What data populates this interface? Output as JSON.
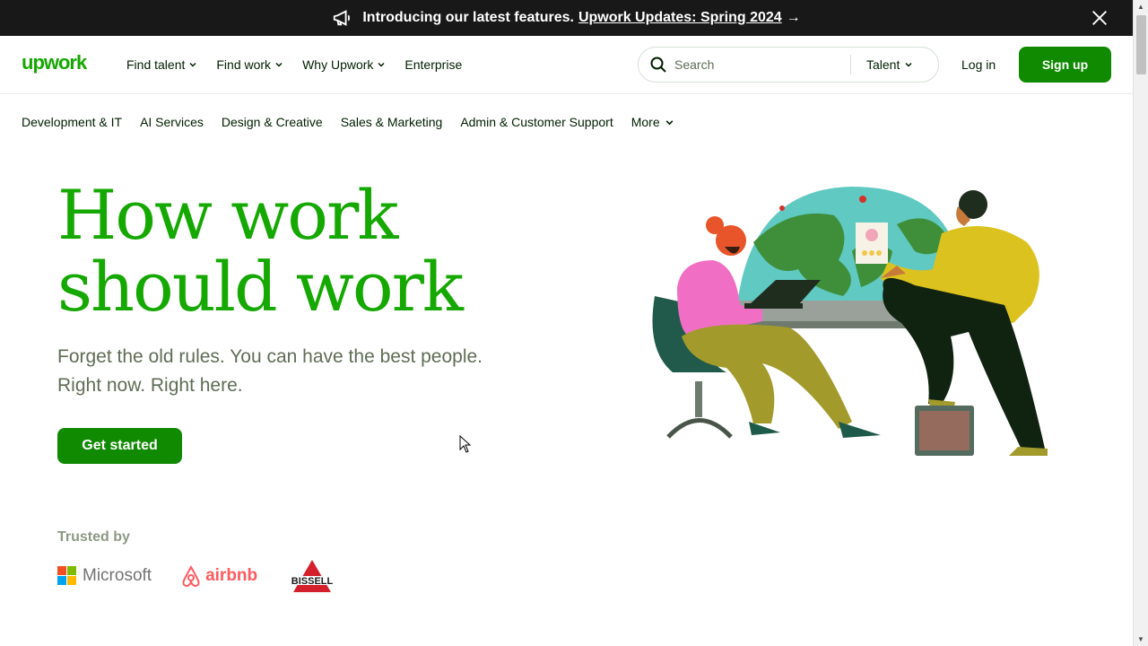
{
  "announcement": {
    "text": "Introducing our latest features.",
    "link": "Upwork Updates: Spring 2024",
    "arrow": "→",
    "icon": "megaphone-icon"
  },
  "header": {
    "logo": "upwork",
    "nav": [
      "Find talent",
      "Find work",
      "Why Upwork",
      "Enterprise"
    ],
    "search_placeholder": "Search",
    "search_scope": "Talent",
    "login": "Log in",
    "signup": "Sign up"
  },
  "categories": [
    "Development & IT",
    "AI Services",
    "Design & Creative",
    "Sales & Marketing",
    "Admin & Customer Support",
    "More"
  ],
  "hero": {
    "title_line1": "How work",
    "title_line2": "should work",
    "subtitle_line1": "Forget the old rules. You can have the best people.",
    "subtitle_line2": "Right now. Right here.",
    "cta": "Get started"
  },
  "trusted": {
    "label": "Trusted by",
    "logos": [
      "Microsoft",
      "airbnb",
      "BISSELL"
    ]
  },
  "colors": {
    "brand_green": "#14a800",
    "button_green": "#108a00",
    "announce_bg": "#181818"
  }
}
